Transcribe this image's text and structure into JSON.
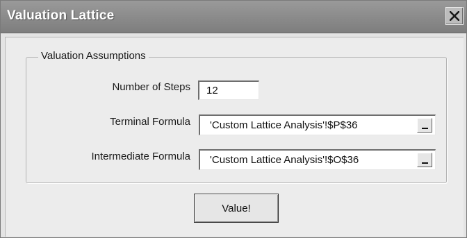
{
  "window": {
    "title": "Valuation Lattice"
  },
  "group": {
    "legend": "Valuation Assumptions"
  },
  "fields": {
    "steps": {
      "label": "Number of Steps",
      "value": "12"
    },
    "terminal": {
      "label": "Terminal Formula",
      "value": "'Custom Lattice Analysis'!$P$36"
    },
    "intermediate": {
      "label": "Intermediate Formula",
      "value": "'Custom Lattice Analysis'!$O$36"
    }
  },
  "buttons": {
    "value_label": "Value!"
  },
  "icons": {
    "close": "close-icon",
    "collapse": "collapse-dialog-icon"
  }
}
